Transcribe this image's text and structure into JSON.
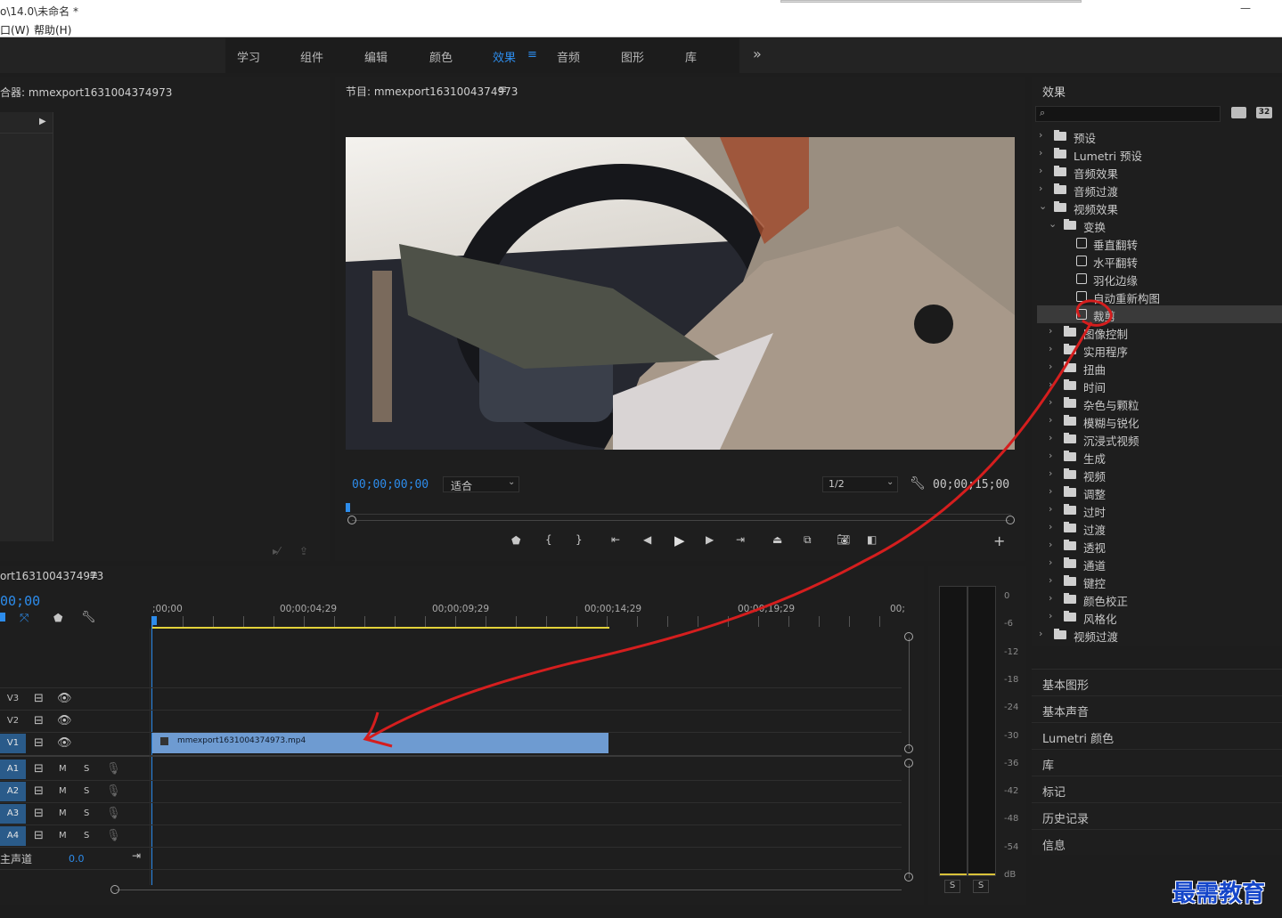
{
  "window": {
    "title": "o\\14.0\\未命名 *",
    "minimize": "—"
  },
  "menu": {
    "items": [
      "口(W)",
      "帮助(H)"
    ]
  },
  "workspace": {
    "tabs": [
      "学习",
      "组件",
      "编辑",
      "颜色",
      "效果",
      "音频",
      "图形",
      "库"
    ],
    "active": "效果",
    "menu_glyph": "≡",
    "overflow": "»"
  },
  "source_panel": {
    "title": "合器: mmexport1631004374973"
  },
  "program": {
    "title": "节目: mmexport1631004374973",
    "menu": "≡",
    "timecode": "00;00;00;00",
    "fit": "适合",
    "resolution": "1/2",
    "duration": "00;00;15;00"
  },
  "effects": {
    "title": "效果",
    "search_placeholder": "",
    "badges": [
      "32"
    ],
    "tree": [
      {
        "label": "预设",
        "level": 0,
        "open": false,
        "kind": "folder-star"
      },
      {
        "label": "Lumetri 预设",
        "level": 0,
        "open": false,
        "kind": "folder-star"
      },
      {
        "label": "音频效果",
        "level": 0,
        "open": false,
        "kind": "folder"
      },
      {
        "label": "音频过渡",
        "level": 0,
        "open": false,
        "kind": "folder"
      },
      {
        "label": "视频效果",
        "level": 0,
        "open": true,
        "kind": "folder"
      },
      {
        "label": "变换",
        "level": 1,
        "open": true,
        "kind": "folder"
      },
      {
        "label": "垂直翻转",
        "level": 2,
        "kind": "effect"
      },
      {
        "label": "水平翻转",
        "level": 2,
        "kind": "effect"
      },
      {
        "label": "羽化边缘",
        "level": 2,
        "kind": "effect"
      },
      {
        "label": "自动重新构图",
        "level": 2,
        "kind": "effect"
      },
      {
        "label": "裁剪",
        "level": 2,
        "kind": "effect",
        "selected": true
      },
      {
        "label": "图像控制",
        "level": 1,
        "open": false,
        "kind": "folder"
      },
      {
        "label": "实用程序",
        "level": 1,
        "open": false,
        "kind": "folder"
      },
      {
        "label": "扭曲",
        "level": 1,
        "open": false,
        "kind": "folder"
      },
      {
        "label": "时间",
        "level": 1,
        "open": false,
        "kind": "folder"
      },
      {
        "label": "杂色与颗粒",
        "level": 1,
        "open": false,
        "kind": "folder"
      },
      {
        "label": "模糊与锐化",
        "level": 1,
        "open": false,
        "kind": "folder"
      },
      {
        "label": "沉浸式视频",
        "level": 1,
        "open": false,
        "kind": "folder"
      },
      {
        "label": "生成",
        "level": 1,
        "open": false,
        "kind": "folder"
      },
      {
        "label": "视频",
        "level": 1,
        "open": false,
        "kind": "folder"
      },
      {
        "label": "调整",
        "level": 1,
        "open": false,
        "kind": "folder"
      },
      {
        "label": "过时",
        "level": 1,
        "open": false,
        "kind": "folder"
      },
      {
        "label": "过渡",
        "level": 1,
        "open": false,
        "kind": "folder"
      },
      {
        "label": "透视",
        "level": 1,
        "open": false,
        "kind": "folder"
      },
      {
        "label": "通道",
        "level": 1,
        "open": false,
        "kind": "folder"
      },
      {
        "label": "键控",
        "level": 1,
        "open": false,
        "kind": "folder"
      },
      {
        "label": "颜色校正",
        "level": 1,
        "open": false,
        "kind": "folder"
      },
      {
        "label": "风格化",
        "level": 1,
        "open": false,
        "kind": "folder"
      },
      {
        "label": "视频过渡",
        "level": 0,
        "open": false,
        "kind": "folder"
      }
    ]
  },
  "side_sections": [
    "基本图形",
    "基本声音",
    "Lumetri 颜色",
    "库",
    "标记",
    "历史记录",
    "信息"
  ],
  "timeline": {
    "title": "ort1631004374973",
    "menu": "≡",
    "timecode": "00;00",
    "ruler": [
      ";00;00",
      "00;00;04;29",
      "00;00;09;29",
      "00;00;14;29",
      "00;00;19;29",
      "00;"
    ],
    "video_tracks": [
      "V3",
      "V2",
      "V1"
    ],
    "audio_tracks": [
      "A1",
      "A2",
      "A3",
      "A4"
    ],
    "mute": "M",
    "solo": "S",
    "master_label": "主声道",
    "master_value": "0.0",
    "clip_name": "mmexport1631004374973.mp4"
  },
  "meter": {
    "scale": [
      "0",
      "-6",
      "-12",
      "-18",
      "-24",
      "-30",
      "-36",
      "-42",
      "-48",
      "-54",
      "dB"
    ],
    "solo": [
      "S",
      "S"
    ]
  },
  "watermark": "最需教育"
}
